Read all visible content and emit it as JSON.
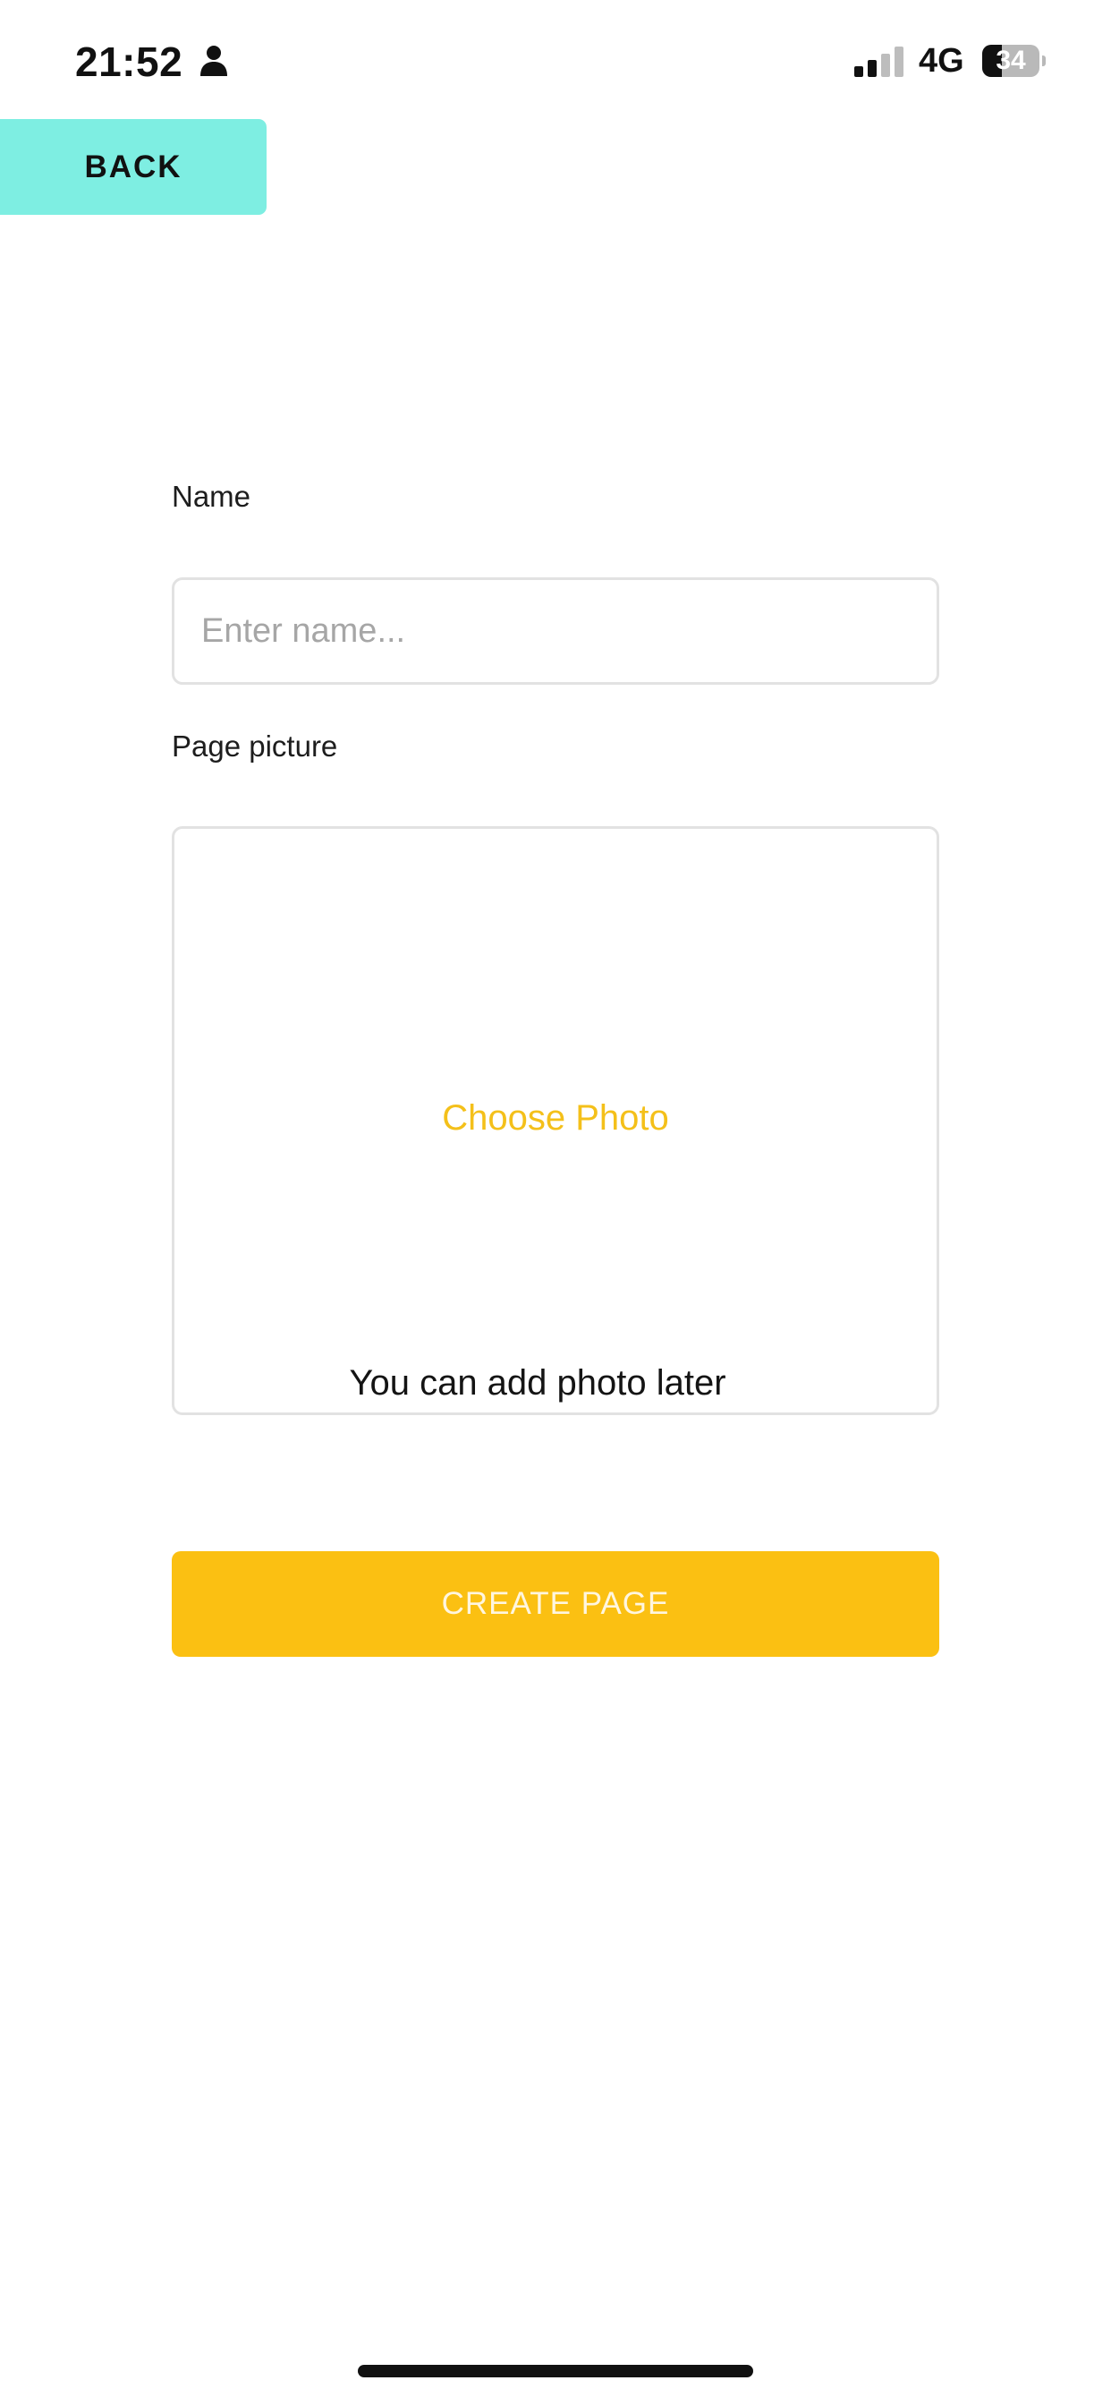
{
  "status_bar": {
    "time": "21:52",
    "network": "4G",
    "battery_level": "34",
    "battery_fraction": 0.34
  },
  "toolbar": {
    "back_label": "BACK"
  },
  "form": {
    "name_label": "Name",
    "name_placeholder": "Enter name...",
    "name_value": "",
    "picture_label": "Page picture",
    "choose_photo_label": "Choose Photo",
    "photo_hint": "You can add photo later",
    "create_label": "CREATE PAGE"
  },
  "icons": {
    "person": "person-icon",
    "signal": "signal-icon",
    "battery": "battery-icon"
  },
  "colors": {
    "back_button": "#7eeee2",
    "accent": "#fbc012",
    "choose_photo": "#f4c01a",
    "border": "#e2e2e2"
  }
}
